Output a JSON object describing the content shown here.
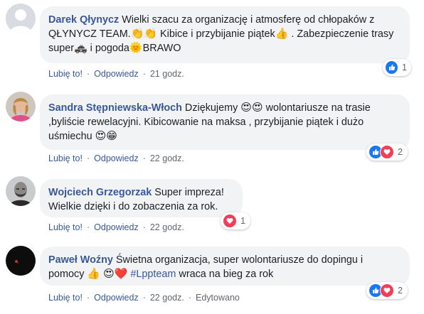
{
  "actions": {
    "like": "Lubię to!",
    "reply": "Odpowiedz",
    "edited": "Edytowano"
  },
  "colors": {
    "link": "#385898",
    "bubble": "#f2f3f5",
    "like_blue": "#1877f2",
    "love_red": "#f33e58"
  },
  "comments": [
    {
      "author": "Darek Qłynycz",
      "text_parts": [
        "Wielki szacu za organizację i atmosferę od chłopaków z QŁYNYCZ TEAM.",
        " Kibice i przybijanie piątek",
        " . Zabezpieczenie trasy super",
        " i pogoda",
        "BRAWO"
      ],
      "emoji": [
        "👏",
        "👏",
        "👍",
        "🚓",
        "🌞"
      ],
      "time": "21 godz.",
      "reactions": [
        "like"
      ],
      "reaction_count": "1",
      "avatar": "default-avatar"
    },
    {
      "author": "Sandra Stępniewska-Włoch",
      "text_parts": [
        "Dziękujemy",
        " wolontariusze na trasie ,byliście rewelacyjni. Kibicowanie na maksa , przybijanie piątek i dużo uśmiechu"
      ],
      "emoji": [
        "😍",
        "😍",
        "😍",
        "😁"
      ],
      "time": "22 godz.",
      "reactions": [
        "like",
        "love"
      ],
      "reaction_count": "2",
      "avatar": "photo-avatar"
    },
    {
      "author": "Wojciech Grzegorzak",
      "text_parts": [
        "Super impreza!",
        "Wielkie dzięki i do zobaczenia za rok."
      ],
      "emoji": [],
      "time": "22 godz.",
      "reactions": [
        "love"
      ],
      "reaction_count": "1",
      "avatar": "photo-avatar"
    },
    {
      "author": "Paweł Woźny",
      "text_parts": [
        "Świetna organizacja, super wolontariusze do dopingu i pomocy",
        "#Lppteam",
        " wraca na bieg za rok"
      ],
      "emoji": [
        "👍",
        "😍",
        "❤️"
      ],
      "time": "22 godz.",
      "reactions": [
        "like",
        "love"
      ],
      "reaction_count": "2",
      "avatar": "photo-avatar"
    }
  ]
}
